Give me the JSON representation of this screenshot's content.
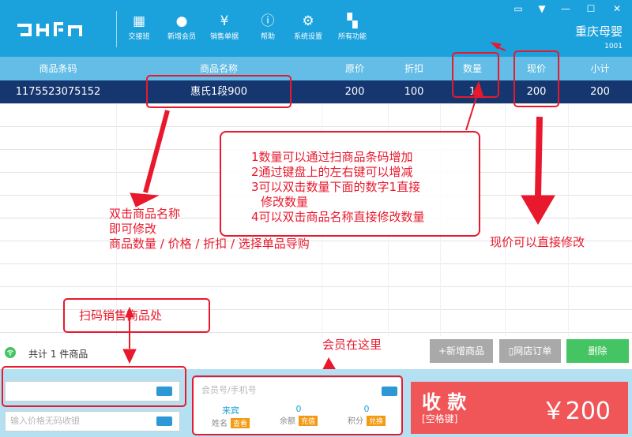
{
  "app": {
    "toolbar": [
      {
        "label": "交接班",
        "icon": "shift-icon"
      },
      {
        "label": "新增会员",
        "icon": "member-icon"
      },
      {
        "label": "销售单据",
        "icon": "receipt-icon"
      },
      {
        "label": "帮助",
        "icon": "info-icon"
      },
      {
        "label": "系统设置",
        "icon": "gear-icon"
      },
      {
        "label": "所有功能",
        "icon": "grid-icon"
      }
    ],
    "store_name": "重庆母婴",
    "store_id": "1001"
  },
  "table": {
    "headers": [
      "商品条码",
      "商品名称",
      "原价",
      "折扣",
      "数量",
      "现价",
      "小计"
    ],
    "rows": [
      [
        "1175523075152",
        "惠氏1段900",
        "200",
        "100",
        "1",
        "200",
        "200"
      ]
    ]
  },
  "annotations": {
    "name_tip": [
      "双击商品名称",
      "即可修改",
      "商品数量 / 价格 / 折扣 / 选择单品导购"
    ],
    "qty_tip": [
      "1数量可以通过扫商品条码增加",
      "2通过键盘上的左右键可以增减",
      "3可以双击数量下面的数字1直接",
      "修改数量",
      "4可以双击商品名称直接修改数量"
    ],
    "price_tip": "现价可以直接修改",
    "scan_tip": "扫码销售商品处",
    "member_tip": "会员在这里"
  },
  "footer": {
    "count_text": "共计 1 件商品",
    "add_button": "+新增商品",
    "order_button": "网店订单",
    "delete_button": "删除",
    "price_placeholder": "输入价格无码收银",
    "member_placeholder": "会员号/手机号",
    "member_name_value": "来宾",
    "member_name_label": "姓名",
    "member_name_tag": "查看",
    "balance_value": "0",
    "balance_label": "余额",
    "balance_tag": "充值",
    "points_value": "0",
    "points_label": "积分",
    "points_tag": "兑换",
    "pay_title": "收 款",
    "pay_sub": "[空格键]",
    "pay_amount": "￥200"
  }
}
